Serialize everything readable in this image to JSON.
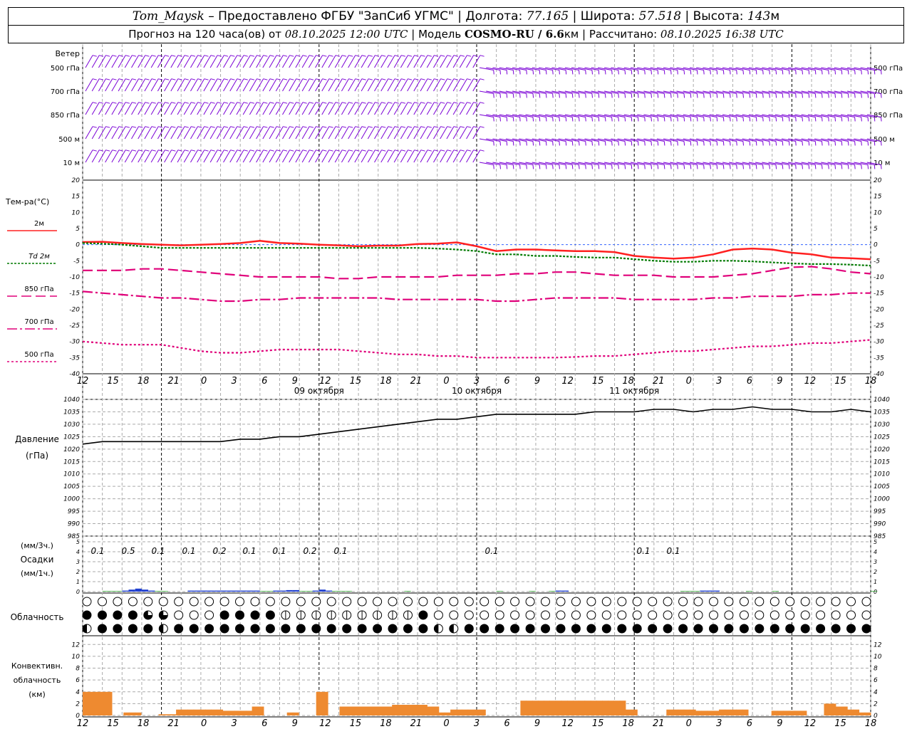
{
  "header": {
    "station": "Tom_Maysk",
    "dash": " – Предоставлено ФГБУ \"ЗапСиб УГМС\" | Долгота: ",
    "lon": "77.165",
    "lat_label": " | Широта: ",
    "lat": "57.518",
    "alt_label": " | Высота: ",
    "alt": "143",
    "alt_unit": "м",
    "forecast_label": "Прогноз на 120 часа(ов) от ",
    "forecast_time": "08.10.2025 12:00 UTC",
    "model_label": " | Модель ",
    "model": "COSMO-RU / 6.6",
    "model_unit": "км",
    "calc_label": " | Рассчитано: ",
    "calc_time": "08.10.2025 16:38 UTC"
  },
  "time_axis": {
    "hour_labels": [
      "12",
      "15",
      "18",
      "21",
      "0",
      "3",
      "6",
      "9",
      "12",
      "15",
      "18",
      "21",
      "0",
      "3",
      "6",
      "9",
      "12",
      "15",
      "18",
      "21",
      "0",
      "3",
      "6",
      "9",
      "12",
      "15",
      "18"
    ],
    "day_labels": [
      "09 октября",
      "10 октября",
      "11 октября"
    ]
  },
  "wind_panel": {
    "title": "Ветер",
    "levels": [
      "500 гПа",
      "700 гПа",
      "850 гПа",
      "500 м",
      "10 м"
    ],
    "color": "#7a00d6"
  },
  "temp_panel": {
    "title": "Тем-ра(°C)",
    "legend": [
      {
        "label": "2м",
        "prefix": "",
        "color": "#ff2020",
        "style": "solid"
      },
      {
        "label": "2м",
        "prefix": "Td",
        "color": "#007a00",
        "style": "dotted"
      },
      {
        "label": "850 гПа",
        "prefix": "",
        "color": "#e0007a",
        "style": "dash"
      },
      {
        "label": "700 гПа",
        "prefix": "",
        "color": "#e0007a",
        "style": "dashdot"
      },
      {
        "label": "500 гПа",
        "prefix": "",
        "color": "#e0007a",
        "style": "dot"
      }
    ],
    "ticks": [
      "20",
      "15",
      "10",
      "5",
      "0",
      "-5",
      "-10",
      "-15",
      "-20",
      "-25",
      "-30",
      "-35",
      "-40"
    ]
  },
  "pressure_panel": {
    "title1": "Давление",
    "title2": "(гПа)",
    "ticks": [
      "1040",
      "1035",
      "1030",
      "1025",
      "1020",
      "1015",
      "1010",
      "1005",
      "1000",
      "995",
      "990",
      "985"
    ]
  },
  "precip_panel": {
    "title1": "(мм/3ч.)",
    "title2": "Осадки",
    "title3": "(мм/1ч.)",
    "ticks": [
      "5",
      "4",
      "3",
      "2",
      "1",
      "0"
    ],
    "labels": [
      "0.1",
      "0.5",
      "0.1",
      "0.1",
      "0.2",
      "0.1",
      "0.1",
      "0.2",
      "0.1",
      "0.1",
      "0.1",
      "0.1"
    ]
  },
  "cloud_panel": {
    "title": "Облачность"
  },
  "conv_panel": {
    "title1": "Конвективн.",
    "title2": "облачность",
    "title3": "(км)",
    "ticks": [
      "12",
      "10",
      "8",
      "6",
      "4",
      "2",
      "0"
    ]
  },
  "chart_data": [
    {
      "type": "line",
      "name": "temperature",
      "x_hours": [
        0,
        3,
        6,
        9,
        12,
        15,
        18,
        21,
        24,
        27,
        30,
        33,
        36,
        39,
        42,
        45,
        48,
        51,
        54,
        57,
        60,
        63,
        66,
        69,
        72,
        75,
        78,
        81,
        84,
        87,
        90,
        93,
        96,
        99,
        102,
        105,
        108,
        111,
        114,
        117,
        120
      ],
      "ylim": [
        -40,
        20
      ],
      "series": [
        {
          "name": "2м",
          "values": [
            0.8,
            0.9,
            0.5,
            0.2,
            0,
            -0.2,
            0,
            0.2,
            0.5,
            1.2,
            0.5,
            0.3,
            0,
            -0.2,
            -0.5,
            -0.3,
            -0.3,
            0.2,
            0.3,
            0.7,
            -0.5,
            -2,
            -1.5,
            -1.5,
            -1.8,
            -2,
            -2,
            -2.3,
            -3.5,
            -4,
            -4.3,
            -4,
            -3,
            -1.5,
            -1.2,
            -1.5,
            -2.5,
            -3,
            -4,
            -4.2,
            -4.5
          ]
        },
        {
          "name": "Td 2м",
          "values": [
            0.5,
            0.3,
            0,
            -0.5,
            -1,
            -1,
            -1,
            -1,
            -1,
            -1,
            -1,
            -1,
            -1,
            -1,
            -1,
            -1,
            -1,
            -1,
            -1.2,
            -1.5,
            -2,
            -3,
            -3,
            -3.5,
            -3.5,
            -3.8,
            -4,
            -4,
            -4.5,
            -5,
            -5.3,
            -5.3,
            -5,
            -5,
            -5.2,
            -5.5,
            -5.8,
            -6,
            -6,
            -6.2,
            -6.5
          ]
        },
        {
          "name": "850 гПа",
          "values": [
            -8,
            -8,
            -8,
            -7.5,
            -7.5,
            -8,
            -8.5,
            -9,
            -9.5,
            -10,
            -10,
            -10,
            -10,
            -10.5,
            -10.5,
            -10,
            -10,
            -10,
            -10,
            -9.5,
            -9.5,
            -9.5,
            -9,
            -9,
            -8.5,
            -8.5,
            -9,
            -9.5,
            -9.5,
            -9.5,
            -10,
            -10,
            -10,
            -9.5,
            -9,
            -8,
            -7,
            -6.8,
            -7.5,
            -8.5,
            -9
          ]
        },
        {
          "name": "700 гПа",
          "values": [
            -14.5,
            -15,
            -15.5,
            -16,
            -16.5,
            -16.5,
            -17,
            -17.5,
            -17.5,
            -17,
            -17,
            -16.5,
            -16.5,
            -16.5,
            -16.5,
            -16.5,
            -17,
            -17,
            -17,
            -17,
            -17,
            -17.5,
            -17.5,
            -17,
            -16.5,
            -16.5,
            -16.5,
            -16.5,
            -17,
            -17,
            -17,
            -17,
            -16.5,
            -16.5,
            -16,
            -16,
            -16,
            -15.5,
            -15.5,
            -15,
            -15
          ]
        },
        {
          "name": "500 гПа",
          "values": [
            -30,
            -30.5,
            -31,
            -31,
            -31,
            -32,
            -33,
            -33.5,
            -33.5,
            -33,
            -32.5,
            -32.5,
            -32.5,
            -32.5,
            -33,
            -33.5,
            -34,
            -34,
            -34.5,
            -34.5,
            -35,
            -35,
            -35,
            -35,
            -35,
            -34.8,
            -34.5,
            -34.5,
            -34,
            -33.5,
            -33,
            -33,
            -32.5,
            -32,
            -31.5,
            -31.5,
            -31,
            -30.5,
            -30.5,
            -30,
            -29.5
          ]
        }
      ]
    },
    {
      "type": "line",
      "name": "pressure",
      "x_hours": [
        0,
        3,
        6,
        9,
        12,
        15,
        18,
        21,
        24,
        27,
        30,
        33,
        36,
        39,
        42,
        45,
        48,
        51,
        54,
        57,
        60,
        63,
        66,
        69,
        72,
        75,
        78,
        81,
        84,
        87,
        90,
        93,
        96,
        99,
        102,
        105,
        108,
        111,
        114,
        117,
        120
      ],
      "ylim": [
        985,
        1040
      ],
      "series": [
        {
          "name": "Давление",
          "values": [
            1022,
            1023,
            1023,
            1023,
            1023,
            1023,
            1023,
            1023,
            1024,
            1024,
            1025,
            1025,
            1026,
            1027,
            1028,
            1029,
            1030,
            1031,
            1032,
            1032,
            1033,
            1034,
            1034,
            1034,
            1034,
            1034,
            1035,
            1035,
            1035,
            1036,
            1036,
            1035,
            1036,
            1036,
            1037,
            1036,
            1036,
            1035,
            1035,
            1036,
            1035
          ]
        }
      ]
    },
    {
      "type": "bar",
      "name": "precipitation_1h",
      "x_hours_step": 1,
      "ylim": [
        0,
        5
      ],
      "values": [
        0,
        0,
        0,
        0.05,
        0.05,
        0.05,
        0.1,
        0.2,
        0.3,
        0.2,
        0.1,
        0.05,
        0.05,
        0,
        0,
        0,
        0.1,
        0.1,
        0.1,
        0.1,
        0.1,
        0.1,
        0.1,
        0.1,
        0.1,
        0.1,
        0.1,
        0.05,
        0.05,
        0.1,
        0.1,
        0.15,
        0.15,
        0.05,
        0.05,
        0.1,
        0.2,
        0.1,
        0.05,
        0.05,
        0.05,
        0,
        0,
        0,
        0,
        0,
        0,
        0,
        0,
        0.05,
        0,
        0,
        0,
        0,
        0,
        0,
        0,
        0,
        0,
        0,
        0,
        0,
        0,
        0.05,
        0,
        0,
        0,
        0,
        0.05,
        0,
        0,
        0.05,
        0.1,
        0.1,
        0,
        0,
        0,
        0,
        0,
        0,
        0,
        0,
        0,
        0,
        0,
        0,
        0,
        0,
        0,
        0,
        0,
        0.05,
        0.05,
        0.05,
        0.1,
        0.1,
        0.1,
        0,
        0,
        0,
        0,
        0.05,
        0,
        0,
        0,
        0.05,
        0,
        0,
        0,
        0,
        0,
        0,
        0,
        0,
        0,
        0,
        0,
        0,
        0,
        0,
        0.05,
        0,
        0
      ]
    },
    {
      "type": "bar",
      "name": "convective_cloud_km",
      "x_hours_step": 1,
      "ylim": [
        0,
        13
      ],
      "values": [
        4,
        4,
        4,
        4,
        4,
        0,
        0,
        0.5,
        0.5,
        0.5,
        0,
        0,
        0,
        0.2,
        0.2,
        0.2,
        1,
        1,
        1,
        1,
        1,
        1,
        1,
        1,
        0.8,
        0.8,
        0.8,
        0.8,
        0.8,
        1.5,
        1.5,
        0,
        0,
        0,
        0,
        0.5,
        0.5,
        0,
        0,
        0,
        4,
        4,
        0,
        0,
        1.5,
        1.5,
        1.5,
        1.5,
        1.5,
        1.5,
        1.5,
        1.5,
        1.5,
        1.8,
        1.8,
        1.8,
        1.8,
        1.8,
        1.8,
        1.5,
        1.5,
        0.5,
        0.5,
        1,
        1,
        1,
        1,
        1,
        1,
        0,
        0,
        0,
        0,
        0,
        0,
        2.5,
        2.5,
        2.5,
        2.5,
        2.5,
        2.5,
        2.5,
        2.5,
        2.5,
        2.5,
        2.5,
        2.5,
        2.5,
        2.5,
        2.5,
        2.5,
        2.5,
        2.5,
        1,
        1,
        0,
        0,
        0,
        0,
        0,
        1,
        1,
        1,
        1,
        1,
        0.8,
        0.8,
        0.8,
        0.8,
        1,
        1,
        1,
        1,
        1,
        0,
        0,
        0,
        0,
        0.8,
        0.8,
        0.8,
        0.8,
        0.8,
        0.8,
        0,
        0,
        0,
        2,
        2,
        1.5,
        1.5,
        1,
        1,
        0.5,
        0.5
      ]
    },
    {
      "type": "table",
      "name": "cloudiness",
      "rows": {
        "high": "000000000000000000000000000000000000000000000000000000000000000000000000000000000000000000000000000000000000000",
        "mid": "888888883333000000888888882222222222222222222288800000000000000000000000000000000000000000000000000000000000000",
        "low": "488888888848888888888888888888888888888888888883440488888848888888888888888888888888888888888888888888888888888"
      }
    }
  ]
}
